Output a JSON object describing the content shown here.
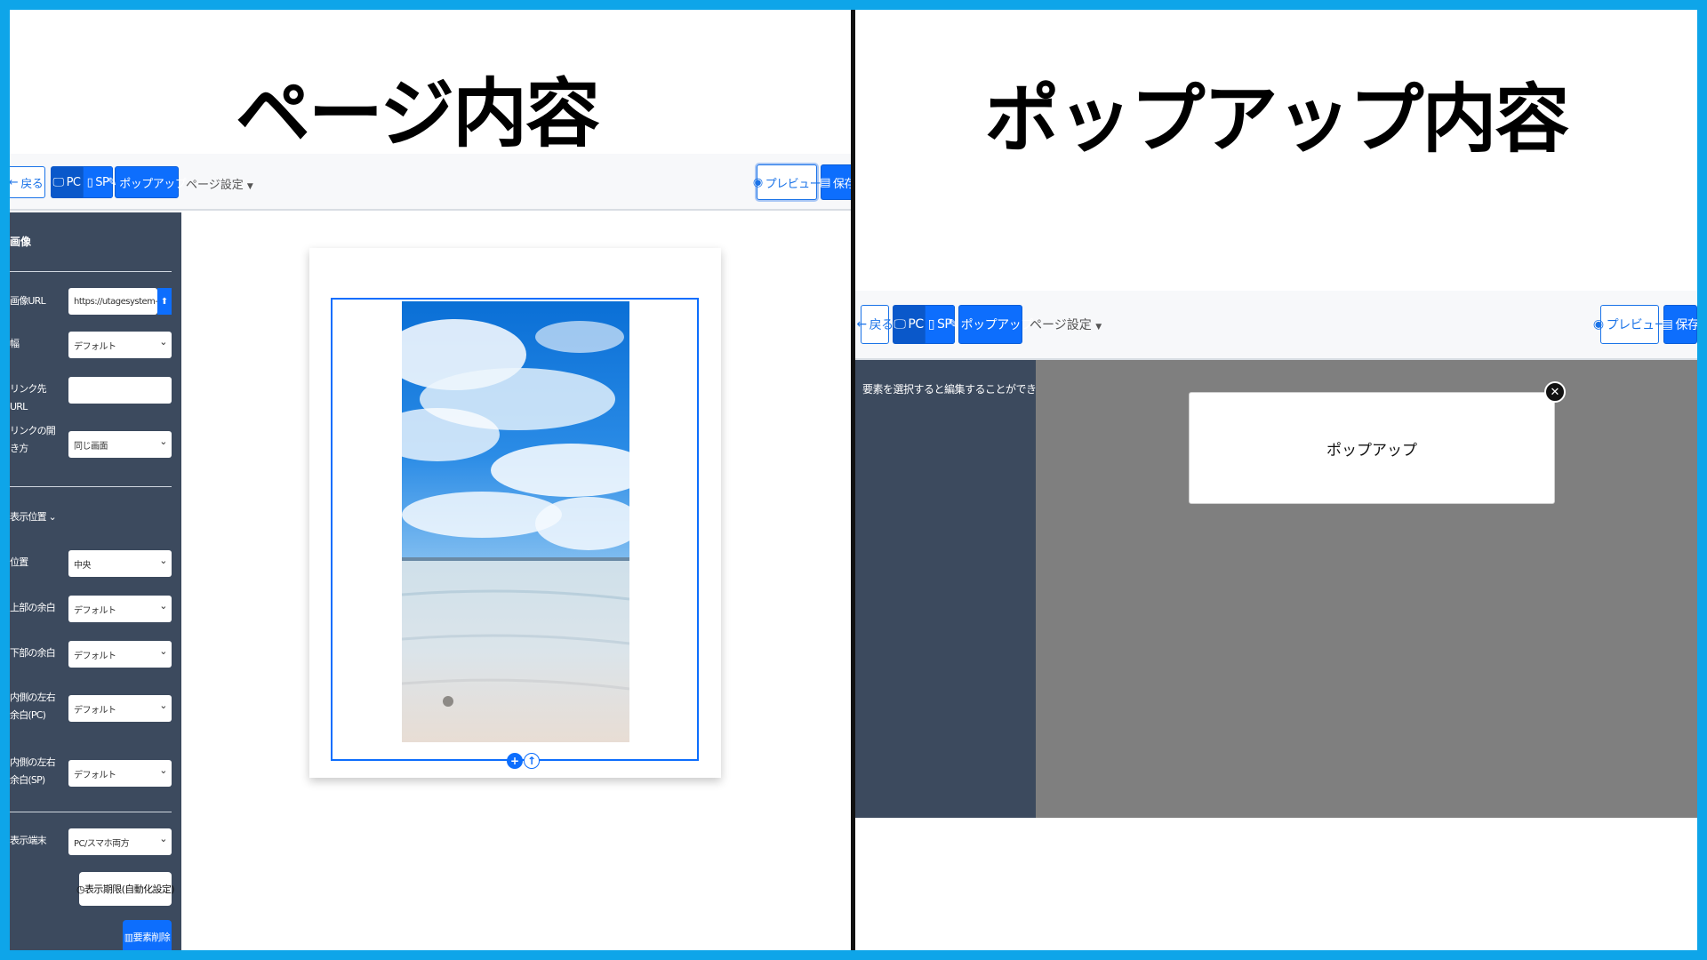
{
  "left": {
    "title": "ページ内容",
    "toolbar": {
      "back": "戻る",
      "pc": "PC",
      "sp": "SP",
      "popup": "ポップアップ",
      "page_settings": "ページ設定",
      "preview": "プレビュー",
      "save": "保存"
    },
    "sidebar": {
      "section": "画像",
      "fields": {
        "image_url_label": "画像URL",
        "image_url_value": "https://utagesystem-stg.s",
        "width_label": "幅",
        "width_value": "デフォルト",
        "link_url_label": "リンク先URL",
        "link_url_value": "",
        "link_open_label": "リンクの開き方",
        "link_open_value": "同じ画面",
        "display_position_label": "表示位置",
        "position_label": "位置",
        "position_value": "中央",
        "top_margin_label": "上部の余白",
        "top_margin_value": "デフォルト",
        "bottom_margin_label": "下部の余白",
        "bottom_margin_value": "デフォルト",
        "inner_pc_label": "内側の左右余白(PC)",
        "inner_pc_value": "デフォルト",
        "inner_sp_label": "内側の左右余白(SP)",
        "inner_sp_value": "デフォルト",
        "device_label": "表示端末",
        "device_value": "PC/スマホ両方"
      },
      "period_button": "表示期限(自動化設定)",
      "delete_button": "要素削除"
    }
  },
  "right": {
    "title": "ポップアップ内容",
    "toolbar": {
      "back": "戻る",
      "pc": "PC",
      "sp": "SP",
      "popup": "ポップアップ",
      "page_settings": "ページ設定",
      "preview": "プレビュー",
      "save": "保存"
    },
    "hint": "要素を選択すると編集することができます",
    "popup_text": "ポップアップ"
  }
}
